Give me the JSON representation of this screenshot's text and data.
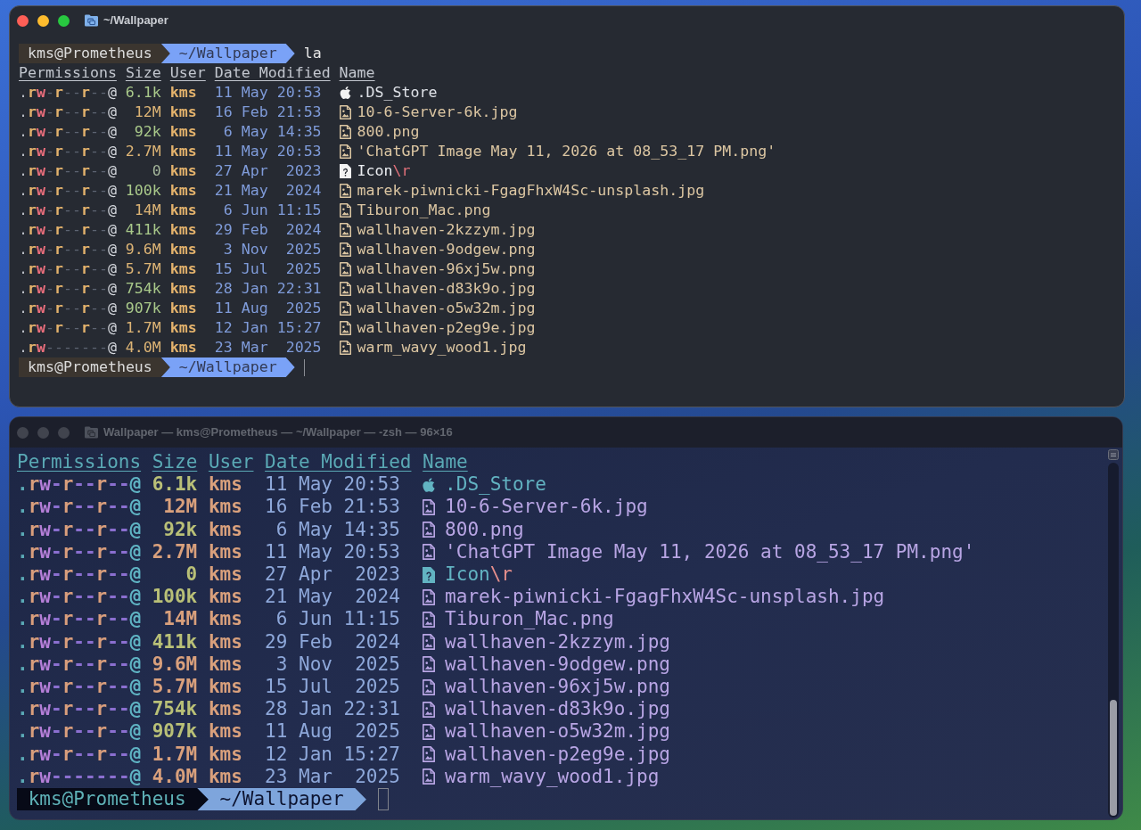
{
  "windows": [
    {
      "focused": true,
      "title": "~/Wallpaper",
      "scrollbar": false,
      "command_prompt": {
        "user": "kms@Prometheus",
        "path": "~/Wallpaper",
        "command": "la"
      },
      "columns": [
        "Permissions",
        "Size",
        "User",
        "Date Modified",
        "Name"
      ],
      "rows": [
        {
          "permissions": ".rw-r--r--@",
          "size": {
            "text": "6.1k",
            "kind": "kilobytes"
          },
          "user": "kms",
          "date": "11 May",
          "time": "20:53",
          "kind": "system",
          "name": ".DS_Store"
        },
        {
          "permissions": ".rw-r--r--@",
          "size": {
            "text": "12M",
            "kind": "megabytes"
          },
          "user": "kms",
          "date": "16 Feb",
          "time": "21:53",
          "kind": "image",
          "name": "10-6-Server-6k.jpg"
        },
        {
          "permissions": ".rw-r--r--@",
          "size": {
            "text": "92k",
            "kind": "kilobytes"
          },
          "user": "kms",
          "date": "6 May",
          "time": "14:35",
          "kind": "image",
          "name": "800.png"
        },
        {
          "permissions": ".rw-r--r--@",
          "size": {
            "text": "2.7M",
            "kind": "megabytes"
          },
          "user": "kms",
          "date": "11 May",
          "time": "20:53",
          "kind": "image",
          "name": "'ChatGPT Image May 11, 2026 at 08_53_17 PM.png'"
        },
        {
          "permissions": ".rw-r--r--@",
          "size": {
            "text": "0",
            "kind": "bytes"
          },
          "user": "kms",
          "date": "27 Apr",
          "time": "2023",
          "kind": "unknown",
          "name": "Icon",
          "escape": "\\r"
        },
        {
          "permissions": ".rw-r--r--@",
          "size": {
            "text": "100k",
            "kind": "kilobytes"
          },
          "user": "kms",
          "date": "21 May",
          "time": "2024",
          "kind": "image",
          "name": "marek-piwnicki-FgagFhxW4Sc-unsplash.jpg"
        },
        {
          "permissions": ".rw-r--r--@",
          "size": {
            "text": "14M",
            "kind": "megabytes"
          },
          "user": "kms",
          "date": "6 Jun",
          "time": "11:15",
          "kind": "image",
          "name": "Tiburon_Mac.png"
        },
        {
          "permissions": ".rw-r--r--@",
          "size": {
            "text": "411k",
            "kind": "kilobytes"
          },
          "user": "kms",
          "date": "29 Feb",
          "time": "2024",
          "kind": "image",
          "name": "wallhaven-2kzzym.jpg"
        },
        {
          "permissions": ".rw-r--r--@",
          "size": {
            "text": "9.6M",
            "kind": "megabytes"
          },
          "user": "kms",
          "date": "3 Nov",
          "time": "2025",
          "kind": "image",
          "name": "wallhaven-9odgew.png"
        },
        {
          "permissions": ".rw-r--r--@",
          "size": {
            "text": "5.7M",
            "kind": "megabytes"
          },
          "user": "kms",
          "date": "15 Jul",
          "time": "2025",
          "kind": "image",
          "name": "wallhaven-96xj5w.png"
        },
        {
          "permissions": ".rw-r--r--@",
          "size": {
            "text": "754k",
            "kind": "kilobytes"
          },
          "user": "kms",
          "date": "28 Jan",
          "time": "22:31",
          "kind": "image",
          "name": "wallhaven-d83k9o.jpg"
        },
        {
          "permissions": ".rw-r--r--@",
          "size": {
            "text": "907k",
            "kind": "kilobytes"
          },
          "user": "kms",
          "date": "11 Aug",
          "time": "2025",
          "kind": "image",
          "name": "wallhaven-o5w32m.jpg"
        },
        {
          "permissions": ".rw-r--r--@",
          "size": {
            "text": "1.7M",
            "kind": "megabytes"
          },
          "user": "kms",
          "date": "12 Jan",
          "time": "15:27",
          "kind": "image",
          "name": "wallhaven-p2eg9e.jpg"
        },
        {
          "permissions": ".rw-------@",
          "size": {
            "text": "4.0M",
            "kind": "megabytes"
          },
          "user": "kms",
          "date": "23 Mar",
          "time": "2025",
          "kind": "image",
          "name": "warm_wavy_wood1.jpg"
        }
      ],
      "prompt": {
        "user": "kms@Prometheus",
        "path": "~/Wallpaper"
      }
    },
    {
      "focused": false,
      "title": "Wallpaper — kms@Prometheus — ~/Wallpaper — -zsh — 96×16",
      "scrollbar": true,
      "columns": [
        "Permissions",
        "Size",
        "User",
        "Date Modified",
        "Name"
      ],
      "rows": [
        {
          "permissions": ".rw-r--r--@",
          "size": {
            "text": "6.1k",
            "kind": "kilobytes"
          },
          "user": "kms",
          "date": "11 May",
          "time": "20:53",
          "kind": "system",
          "name": ".DS_Store"
        },
        {
          "permissions": ".rw-r--r--@",
          "size": {
            "text": "12M",
            "kind": "megabytes"
          },
          "user": "kms",
          "date": "16 Feb",
          "time": "21:53",
          "kind": "image",
          "name": "10-6-Server-6k.jpg"
        },
        {
          "permissions": ".rw-r--r--@",
          "size": {
            "text": "92k",
            "kind": "kilobytes"
          },
          "user": "kms",
          "date": "6 May",
          "time": "14:35",
          "kind": "image",
          "name": "800.png"
        },
        {
          "permissions": ".rw-r--r--@",
          "size": {
            "text": "2.7M",
            "kind": "megabytes"
          },
          "user": "kms",
          "date": "11 May",
          "time": "20:53",
          "kind": "image",
          "name": "'ChatGPT Image May 11, 2026 at 08_53_17 PM.png'"
        },
        {
          "permissions": ".rw-r--r--@",
          "size": {
            "text": "0",
            "kind": "bytes"
          },
          "user": "kms",
          "date": "27 Apr",
          "time": "2023",
          "kind": "unknown",
          "name": "Icon",
          "escape": "\\r"
        },
        {
          "permissions": ".rw-r--r--@",
          "size": {
            "text": "100k",
            "kind": "kilobytes"
          },
          "user": "kms",
          "date": "21 May",
          "time": "2024",
          "kind": "image",
          "name": "marek-piwnicki-FgagFhxW4Sc-unsplash.jpg"
        },
        {
          "permissions": ".rw-r--r--@",
          "size": {
            "text": "14M",
            "kind": "megabytes"
          },
          "user": "kms",
          "date": "6 Jun",
          "time": "11:15",
          "kind": "image",
          "name": "Tiburon_Mac.png"
        },
        {
          "permissions": ".rw-r--r--@",
          "size": {
            "text": "411k",
            "kind": "kilobytes"
          },
          "user": "kms",
          "date": "29 Feb",
          "time": "2024",
          "kind": "image",
          "name": "wallhaven-2kzzym.jpg"
        },
        {
          "permissions": ".rw-r--r--@",
          "size": {
            "text": "9.6M",
            "kind": "megabytes"
          },
          "user": "kms",
          "date": "3 Nov",
          "time": "2025",
          "kind": "image",
          "name": "wallhaven-9odgew.png"
        },
        {
          "permissions": ".rw-r--r--@",
          "size": {
            "text": "5.7M",
            "kind": "megabytes"
          },
          "user": "kms",
          "date": "15 Jul",
          "time": "2025",
          "kind": "image",
          "name": "wallhaven-96xj5w.png"
        },
        {
          "permissions": ".rw-r--r--@",
          "size": {
            "text": "754k",
            "kind": "kilobytes"
          },
          "user": "kms",
          "date": "28 Jan",
          "time": "22:31",
          "kind": "image",
          "name": "wallhaven-d83k9o.jpg"
        },
        {
          "permissions": ".rw-r--r--@",
          "size": {
            "text": "907k",
            "kind": "kilobytes"
          },
          "user": "kms",
          "date": "11 Aug",
          "time": "2025",
          "kind": "image",
          "name": "wallhaven-o5w32m.jpg"
        },
        {
          "permissions": ".rw-r--r--@",
          "size": {
            "text": "1.7M",
            "kind": "megabytes"
          },
          "user": "kms",
          "date": "12 Jan",
          "time": "15:27",
          "kind": "image",
          "name": "wallhaven-p2eg9e.jpg"
        },
        {
          "permissions": ".rw-------@",
          "size": {
            "text": "4.0M",
            "kind": "megabytes"
          },
          "user": "kms",
          "date": "23 Mar",
          "time": "2025",
          "kind": "image",
          "name": "warm_wavy_wood1.jpg"
        }
      ],
      "prompt": {
        "user": "kms@Prometheus",
        "path": "~/Wallpaper"
      }
    }
  ]
}
